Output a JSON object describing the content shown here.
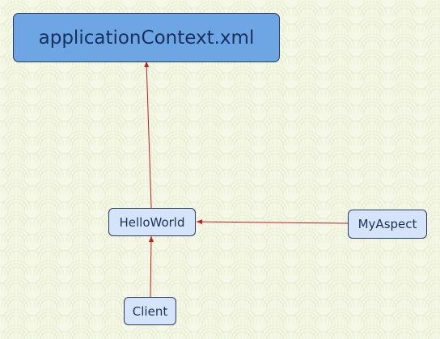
{
  "nodes": {
    "application_context": "applicationContext.xml",
    "hello_world": "HelloWorld",
    "my_aspect": "MyAspect",
    "client": "Client"
  },
  "edges": [
    {
      "from": "HelloWorld",
      "to": "applicationContext.xml"
    },
    {
      "from": "MyAspect",
      "to": "HelloWorld"
    },
    {
      "from": "Client",
      "to": "HelloWorld"
    }
  ],
  "colors": {
    "edge": "#c41e1e",
    "large_node_fill": "#6ea6e4",
    "small_node_fill": "#d6e4fb",
    "node_border": "#2a3c5e",
    "background": "#f5f8e6"
  }
}
